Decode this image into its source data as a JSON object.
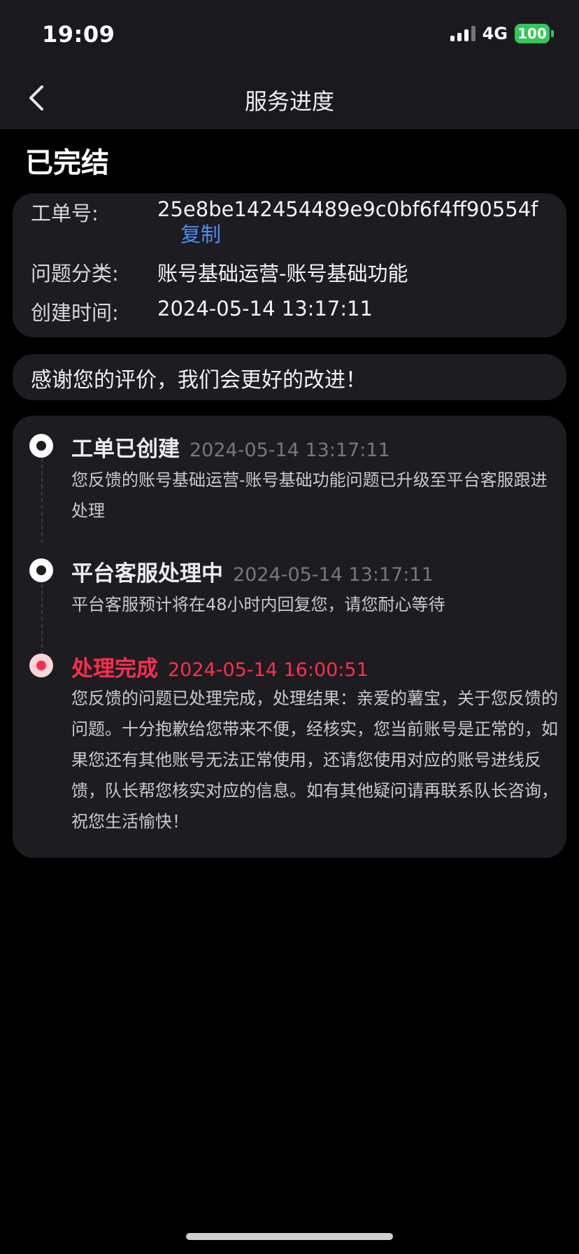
{
  "status_bar": {
    "time": "19:09",
    "network": "4G",
    "battery": "100",
    "battery_color": "#34c759"
  },
  "nav": {
    "back_icon": "chevron-left-icon",
    "title": "服务进度"
  },
  "status_title": "已完结",
  "ticket": {
    "id_label": "工单号:",
    "id_value": "25e8be142454489e9c0bf6f4ff90554f",
    "copy_label": "复制",
    "category_label": "问题分类:",
    "category_value": "账号基础运营-账号基础功能",
    "created_label": "创建时间:",
    "created_value": "2024-05-14 13:17:11"
  },
  "feedback_message": "感谢您的评价，我们会更好的改进！",
  "timeline": [
    {
      "title": "工单已创建",
      "time": "2024-05-14 13:17:11",
      "description": "您反馈的账号基础运营-账号基础功能问题已升级至平台客服跟进处理"
    },
    {
      "title": "平台客服处理中",
      "time": "2024-05-14 13:17:11",
      "description": "平台客服预计将在48小时内回复您，请您耐心等待"
    },
    {
      "title": "处理完成",
      "time": "2024-05-14 16:00:51",
      "description": "您反馈的问题已处理完成，处理结果：亲爱的薯宝，关于您反馈的问题。十分抱歉给您带来不便，经核实，您当前账号是正常的，如果您还有其他账号无法正常使用，还请您使用对应的账号进线反馈，队长帮您核实对应的信息。如有其他疑问请再联系队长咨询，祝您生活愉快！",
      "accent_color": "#ff2e4d"
    }
  ]
}
